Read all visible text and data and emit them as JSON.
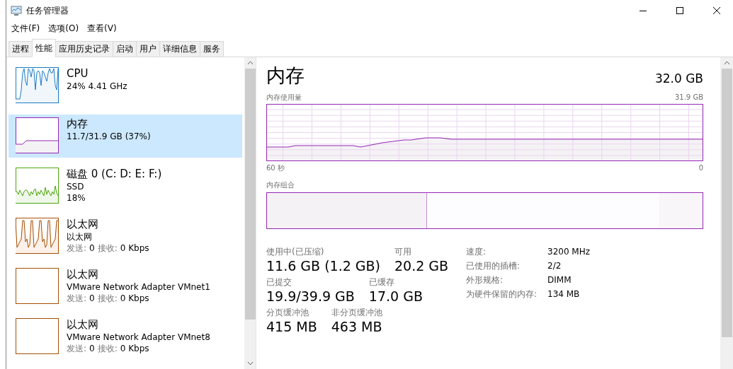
{
  "window": {
    "title": "任务管理器"
  },
  "menu": [
    "文件(F)",
    "选项(O)",
    "查看(V)"
  ],
  "tabs": [
    {
      "label": "进程",
      "selected": false
    },
    {
      "label": "性能",
      "selected": true
    },
    {
      "label": "应用历史记录",
      "selected": false
    },
    {
      "label": "启动",
      "selected": false
    },
    {
      "label": "用户",
      "selected": false
    },
    {
      "label": "详细信息",
      "selected": false
    },
    {
      "label": "服务",
      "selected": false
    }
  ],
  "sidebar": {
    "items": [
      {
        "kind": "cpu",
        "name": "CPU",
        "lines": [
          "24% 4.41 GHz"
        ],
        "selected": false
      },
      {
        "kind": "memory",
        "name": "内存",
        "lines": [
          "11.7/31.9 GB (37%)"
        ],
        "selected": true
      },
      {
        "kind": "disk",
        "name": "磁盘 0 (C: D: E: F:)",
        "lines": [
          "SSD",
          "18%"
        ],
        "selected": false
      },
      {
        "kind": "net",
        "name": "以太网",
        "lines": [
          "以太网"
        ],
        "stats": [
          {
            "label": "发送:",
            "value": "0"
          },
          {
            "label": "接收:",
            "value": "0 Kbps"
          }
        ],
        "active": true,
        "selected": false
      },
      {
        "kind": "net",
        "name": "以太网",
        "lines": [
          "VMware Network Adapter VMnet1"
        ],
        "stats": [
          {
            "label": "发送:",
            "value": "0"
          },
          {
            "label": "接收:",
            "value": "0 Kbps"
          }
        ],
        "active": false,
        "selected": false
      },
      {
        "kind": "net",
        "name": "以太网",
        "lines": [
          "VMware Network Adapter VMnet8"
        ],
        "stats": [
          {
            "label": "发送:",
            "value": "0"
          },
          {
            "label": "接收:",
            "value": "0 Kbps"
          }
        ],
        "active": false,
        "selected": false
      }
    ]
  },
  "detail": {
    "title": "内存",
    "total": "32.0 GB",
    "usage_label": "内存使用量",
    "usage_max": "31.9 GB",
    "time_start": "60 秒",
    "time_end": "0",
    "composition_label": "内存组合",
    "composition": [
      {
        "kind": "in_use",
        "level": 0.368
      },
      {
        "kind": "standby",
        "level": 0.9
      }
    ],
    "stats": [
      [
        {
          "label": "使用中(已压缩)",
          "value": "11.6 GB (1.2 GB)"
        },
        {
          "label": "可用",
          "value": "20.2 GB"
        }
      ],
      [
        {
          "label": "已提交",
          "value": "19.9/39.9 GB"
        },
        {
          "label": "已缓存",
          "value": "17.0 GB"
        }
      ],
      [
        {
          "label": "分页缓冲池",
          "value": "415 MB"
        },
        {
          "label": "非分页缓冲池",
          "value": "463 MB"
        }
      ]
    ],
    "properties": [
      {
        "label": "速度:",
        "value": "3200 MHz"
      },
      {
        "label": "已使用的插槽:",
        "value": "2/2"
      },
      {
        "label": "外形规格:",
        "value": "DIMM"
      },
      {
        "label": "为硬件保留的内存:",
        "value": "134 MB"
      }
    ]
  }
}
